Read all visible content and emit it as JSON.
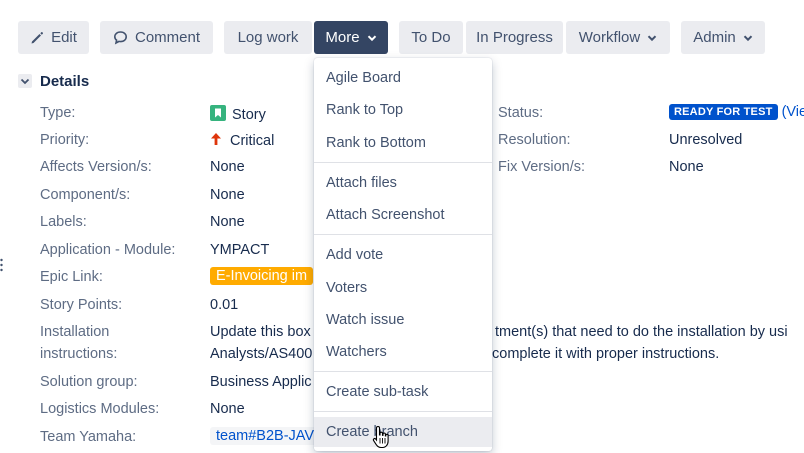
{
  "toolbar": {
    "edit_label": "Edit",
    "comment_label": "Comment",
    "log_work_label": "Log work",
    "more_label": "More",
    "todo_label": "To Do",
    "in_progress_label": "In Progress",
    "workflow_label": "Workflow",
    "admin_label": "Admin"
  },
  "details": {
    "title": "Details",
    "fields": {
      "type": {
        "label": "Type:",
        "value": "Story"
      },
      "priority": {
        "label": "Priority:",
        "value": "Critical"
      },
      "affects": {
        "label": "Affects Version/s:",
        "value": "None"
      },
      "component": {
        "label": "Component/s:",
        "value": "None"
      },
      "labels": {
        "label": "Labels:",
        "value": "None"
      },
      "app_module": {
        "label": "Application - Module:",
        "value": "YMPACT"
      },
      "epic": {
        "label": "Epic Link:",
        "value": "E-Invoicing im"
      },
      "story_points": {
        "label": "Story Points:",
        "value": "0.01"
      },
      "installation": {
        "label_line1": "Installation",
        "label_line2": "instructions:",
        "value_line1": "Update this box",
        "value_line1_tail": "tment(s) that need to do the installation by usi",
        "value_line2": "Analysts/AS400",
        "value_line2_tail": "complete it with proper instructions."
      },
      "solution_group": {
        "label": "Solution group:",
        "value": "Business Applic"
      },
      "logistics": {
        "label": "Logistics Modules:",
        "value": "None"
      },
      "team": {
        "label": "Team Yamaha:",
        "value": "team#B2B-JAV"
      }
    },
    "right": {
      "status": {
        "label": "Status:",
        "badge": "READY FOR TEST",
        "link": "(Vie"
      },
      "resolution": {
        "label": "Resolution:",
        "value": "Unresolved"
      },
      "fix_version": {
        "label": "Fix Version/s:",
        "value": "None"
      }
    }
  },
  "more_menu": {
    "items": [
      "Agile Board",
      "Rank to Top",
      "Rank to Bottom",
      "Attach files",
      "Attach Screenshot",
      "Add vote",
      "Voters",
      "Watch issue",
      "Watchers",
      "Create sub-task",
      "Create branch"
    ],
    "hovered": "Create branch"
  },
  "colors": {
    "accent": "#0052cc",
    "active_button": "#344563",
    "epic": "#ffab00",
    "story_icon": "#36b37e",
    "priority_critical": "#de350b"
  }
}
